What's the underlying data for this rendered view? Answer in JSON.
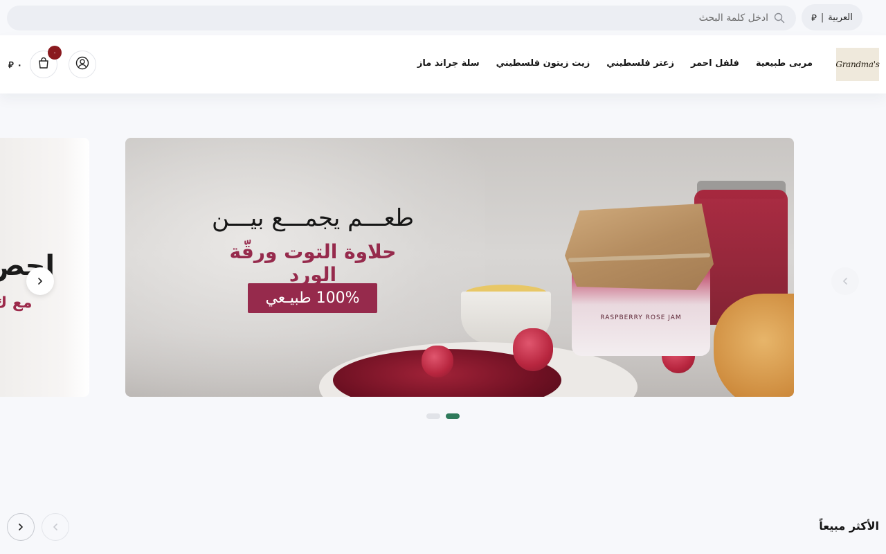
{
  "topbar": {
    "language_label": "العربية",
    "language_separator": "|",
    "currency_symbol": "⃁",
    "search_placeholder": "ادخل كلمة البحث"
  },
  "header": {
    "logo_text": "Grandma's",
    "nav": [
      "مربى طبيعية",
      "فلفل احمر",
      "زعتر فلسطيني",
      "زيت زيتون فلسطيني",
      "سلة جراند ماز"
    ],
    "cart_count": "٠",
    "cart_total": "٠ ⃁"
  },
  "slider": {
    "main_slide": {
      "headline_line1": "طعـــم يجمـــع بيـــن",
      "headline_line2": "حلاوة التوت ورقّة الورد",
      "badge": "100% طبيـعي",
      "jar_label": "RASPBERRY ROSE JAM"
    },
    "peek_slide": {
      "line1": "احص",
      "line2": "مع ك"
    },
    "dots_count": 2,
    "active_dot": 2
  },
  "best_sellers": {
    "title": "الأكثر مبيعاً"
  },
  "colors": {
    "accent_green": "#2f7a5b",
    "brand_red": "#8a1a1f",
    "jam_magenta": "#962a4c"
  },
  "icons": {
    "search": "search-icon",
    "account": "user-circle-icon",
    "cart": "shopping-bag-icon",
    "chevron_left": "chevron-left-icon",
    "chevron_right": "chevron-right-icon"
  }
}
